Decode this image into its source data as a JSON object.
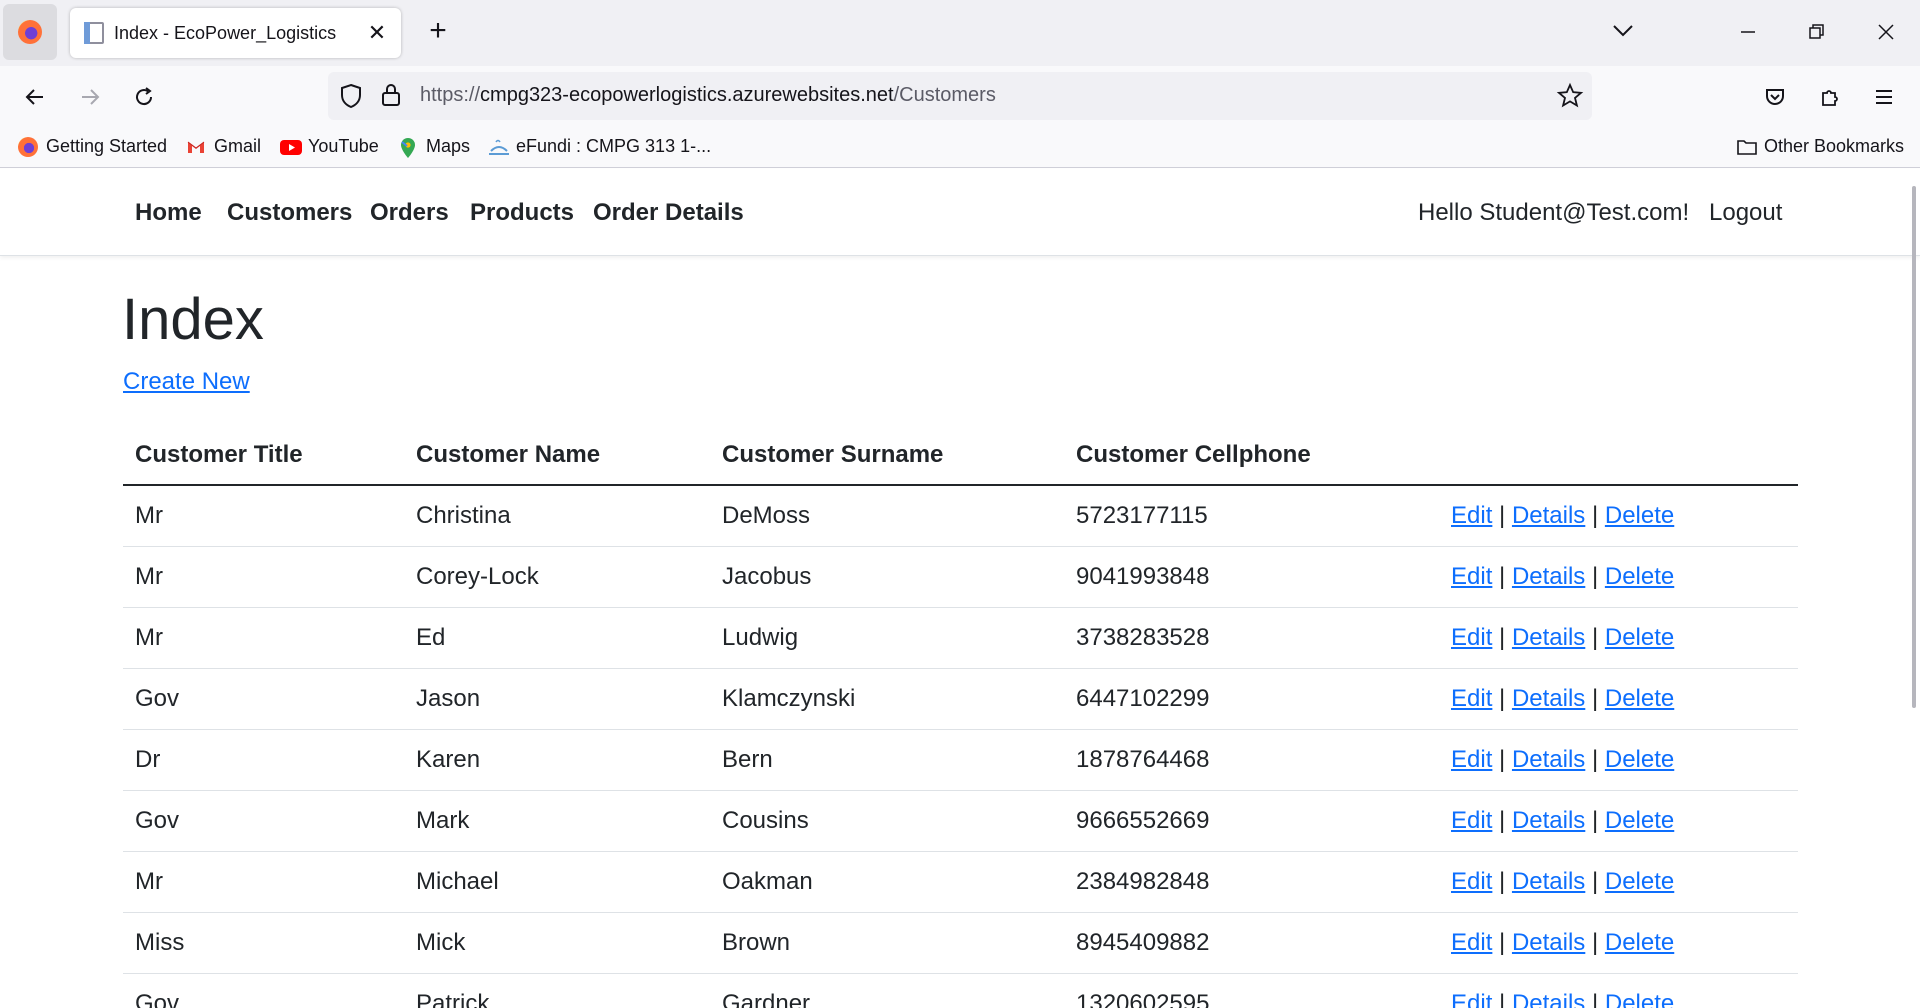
{
  "browser": {
    "tab_title": "Index - EcoPower_Logistics",
    "url_host": "cmpg323-ecopowerlogistics.azurewebsites.net",
    "url_scheme": "https://",
    "url_path": "/Customers",
    "bookmarks": [
      {
        "label": "Getting Started",
        "icon": "firefox-icon"
      },
      {
        "label": "Gmail",
        "icon": "gmail-icon"
      },
      {
        "label": "YouTube",
        "icon": "youtube-icon"
      },
      {
        "label": "Maps",
        "icon": "maps-icon"
      },
      {
        "label": "eFundi : CMPG 313 1-...",
        "icon": "efundi-icon"
      }
    ],
    "other_bookmarks": "Other Bookmarks"
  },
  "site": {
    "nav": [
      "Home",
      "Customers",
      "Orders",
      "Products",
      "Order Details"
    ],
    "greeting": "Hello Student@Test.com!",
    "logout": "Logout"
  },
  "page": {
    "title": "Index",
    "create_new": "Create New",
    "columns": [
      "Customer Title",
      "Customer Name",
      "Customer Surname",
      "Customer Cellphone"
    ],
    "actions": {
      "edit": "Edit",
      "details": "Details",
      "delete": "Delete",
      "separator": "|"
    },
    "rows": [
      {
        "title": "Mr",
        "name": "Christina",
        "surname": "DeMoss",
        "cell": "5723177115"
      },
      {
        "title": "Mr",
        "name": "Corey-Lock",
        "surname": "Jacobus",
        "cell": "9041993848"
      },
      {
        "title": "Mr",
        "name": "Ed",
        "surname": "Ludwig",
        "cell": "3738283528"
      },
      {
        "title": "Gov",
        "name": "Jason",
        "surname": "Klamczynski",
        "cell": "6447102299"
      },
      {
        "title": "Dr",
        "name": "Karen",
        "surname": "Bern",
        "cell": "1878764468"
      },
      {
        "title": "Gov",
        "name": "Mark",
        "surname": "Cousins",
        "cell": "9666552669"
      },
      {
        "title": "Mr",
        "name": "Michael",
        "surname": "Oakman",
        "cell": "2384982848"
      },
      {
        "title": "Miss",
        "name": "Mick",
        "surname": "Brown",
        "cell": "8945409882"
      },
      {
        "title": "Gov",
        "name": "Patrick",
        "surname": "Gardner",
        "cell": "1320602595"
      }
    ]
  },
  "colors": {
    "link": "#0d6efd",
    "text": "#212529",
    "chrome": "#f0f0f4"
  }
}
